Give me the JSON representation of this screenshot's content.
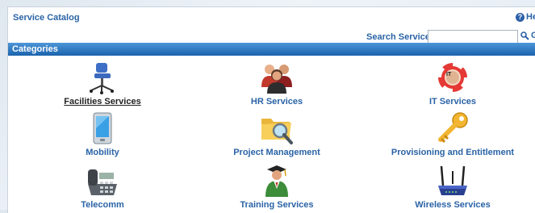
{
  "header": {
    "title": "Service Catalog",
    "help_label": "He"
  },
  "search": {
    "label": "Search Services",
    "placeholder": "",
    "go_label": "G"
  },
  "categories_bar": {
    "label": "Categories"
  },
  "categories": [
    {
      "label": "Facilities Services",
      "icon": "office-chair-icon"
    },
    {
      "label": "HR Services",
      "icon": "people-icon"
    },
    {
      "label": "IT Services",
      "icon": "lifebuoy-icon"
    },
    {
      "label": "Mobility",
      "icon": "smartphone-icon"
    },
    {
      "label": "Project Management",
      "icon": "folder-search-icon"
    },
    {
      "label": "Provisioning and Entitlement",
      "icon": "key-icon"
    },
    {
      "label": "Telecomm",
      "icon": "desk-phone-icon"
    },
    {
      "label": "Training Services",
      "icon": "graduate-icon"
    },
    {
      "label": "Wireless Services",
      "icon": "router-icon"
    }
  ],
  "colors": {
    "link": "#2a63a6",
    "bar_top": "#4d96d8",
    "bar_bottom": "#1b63ad"
  }
}
